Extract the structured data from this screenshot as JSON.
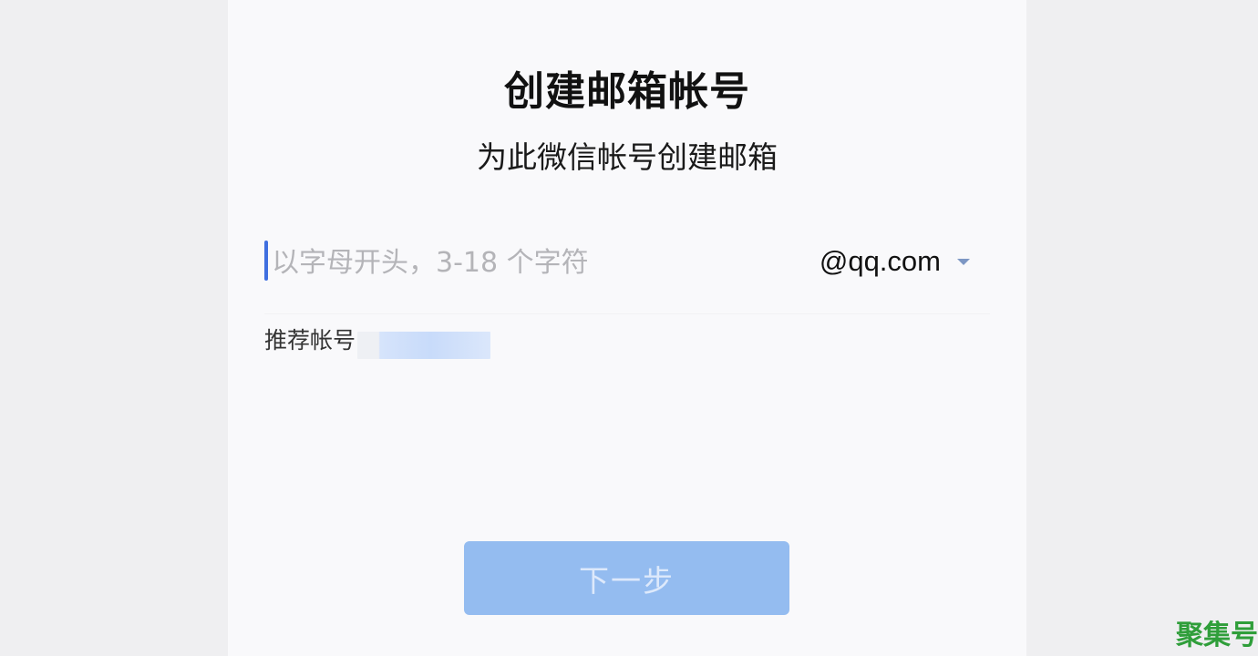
{
  "page": {
    "title": "创建邮箱帐号",
    "subtitle": "为此微信帐号创建邮箱"
  },
  "account_field": {
    "value": "",
    "placeholder": "以字母开头，3-18 个字符"
  },
  "domain_select": {
    "selected": "@qq.com",
    "icon": "caret-down-icon"
  },
  "recommendation": {
    "label": "推荐帐号"
  },
  "actions": {
    "next_label": "下一步",
    "next_enabled": false
  },
  "watermark": {
    "text": "聚集号"
  },
  "colors": {
    "accent": "#3f6fe0",
    "button_disabled": "#94bcf0",
    "watermark": "#2f9e3a"
  }
}
